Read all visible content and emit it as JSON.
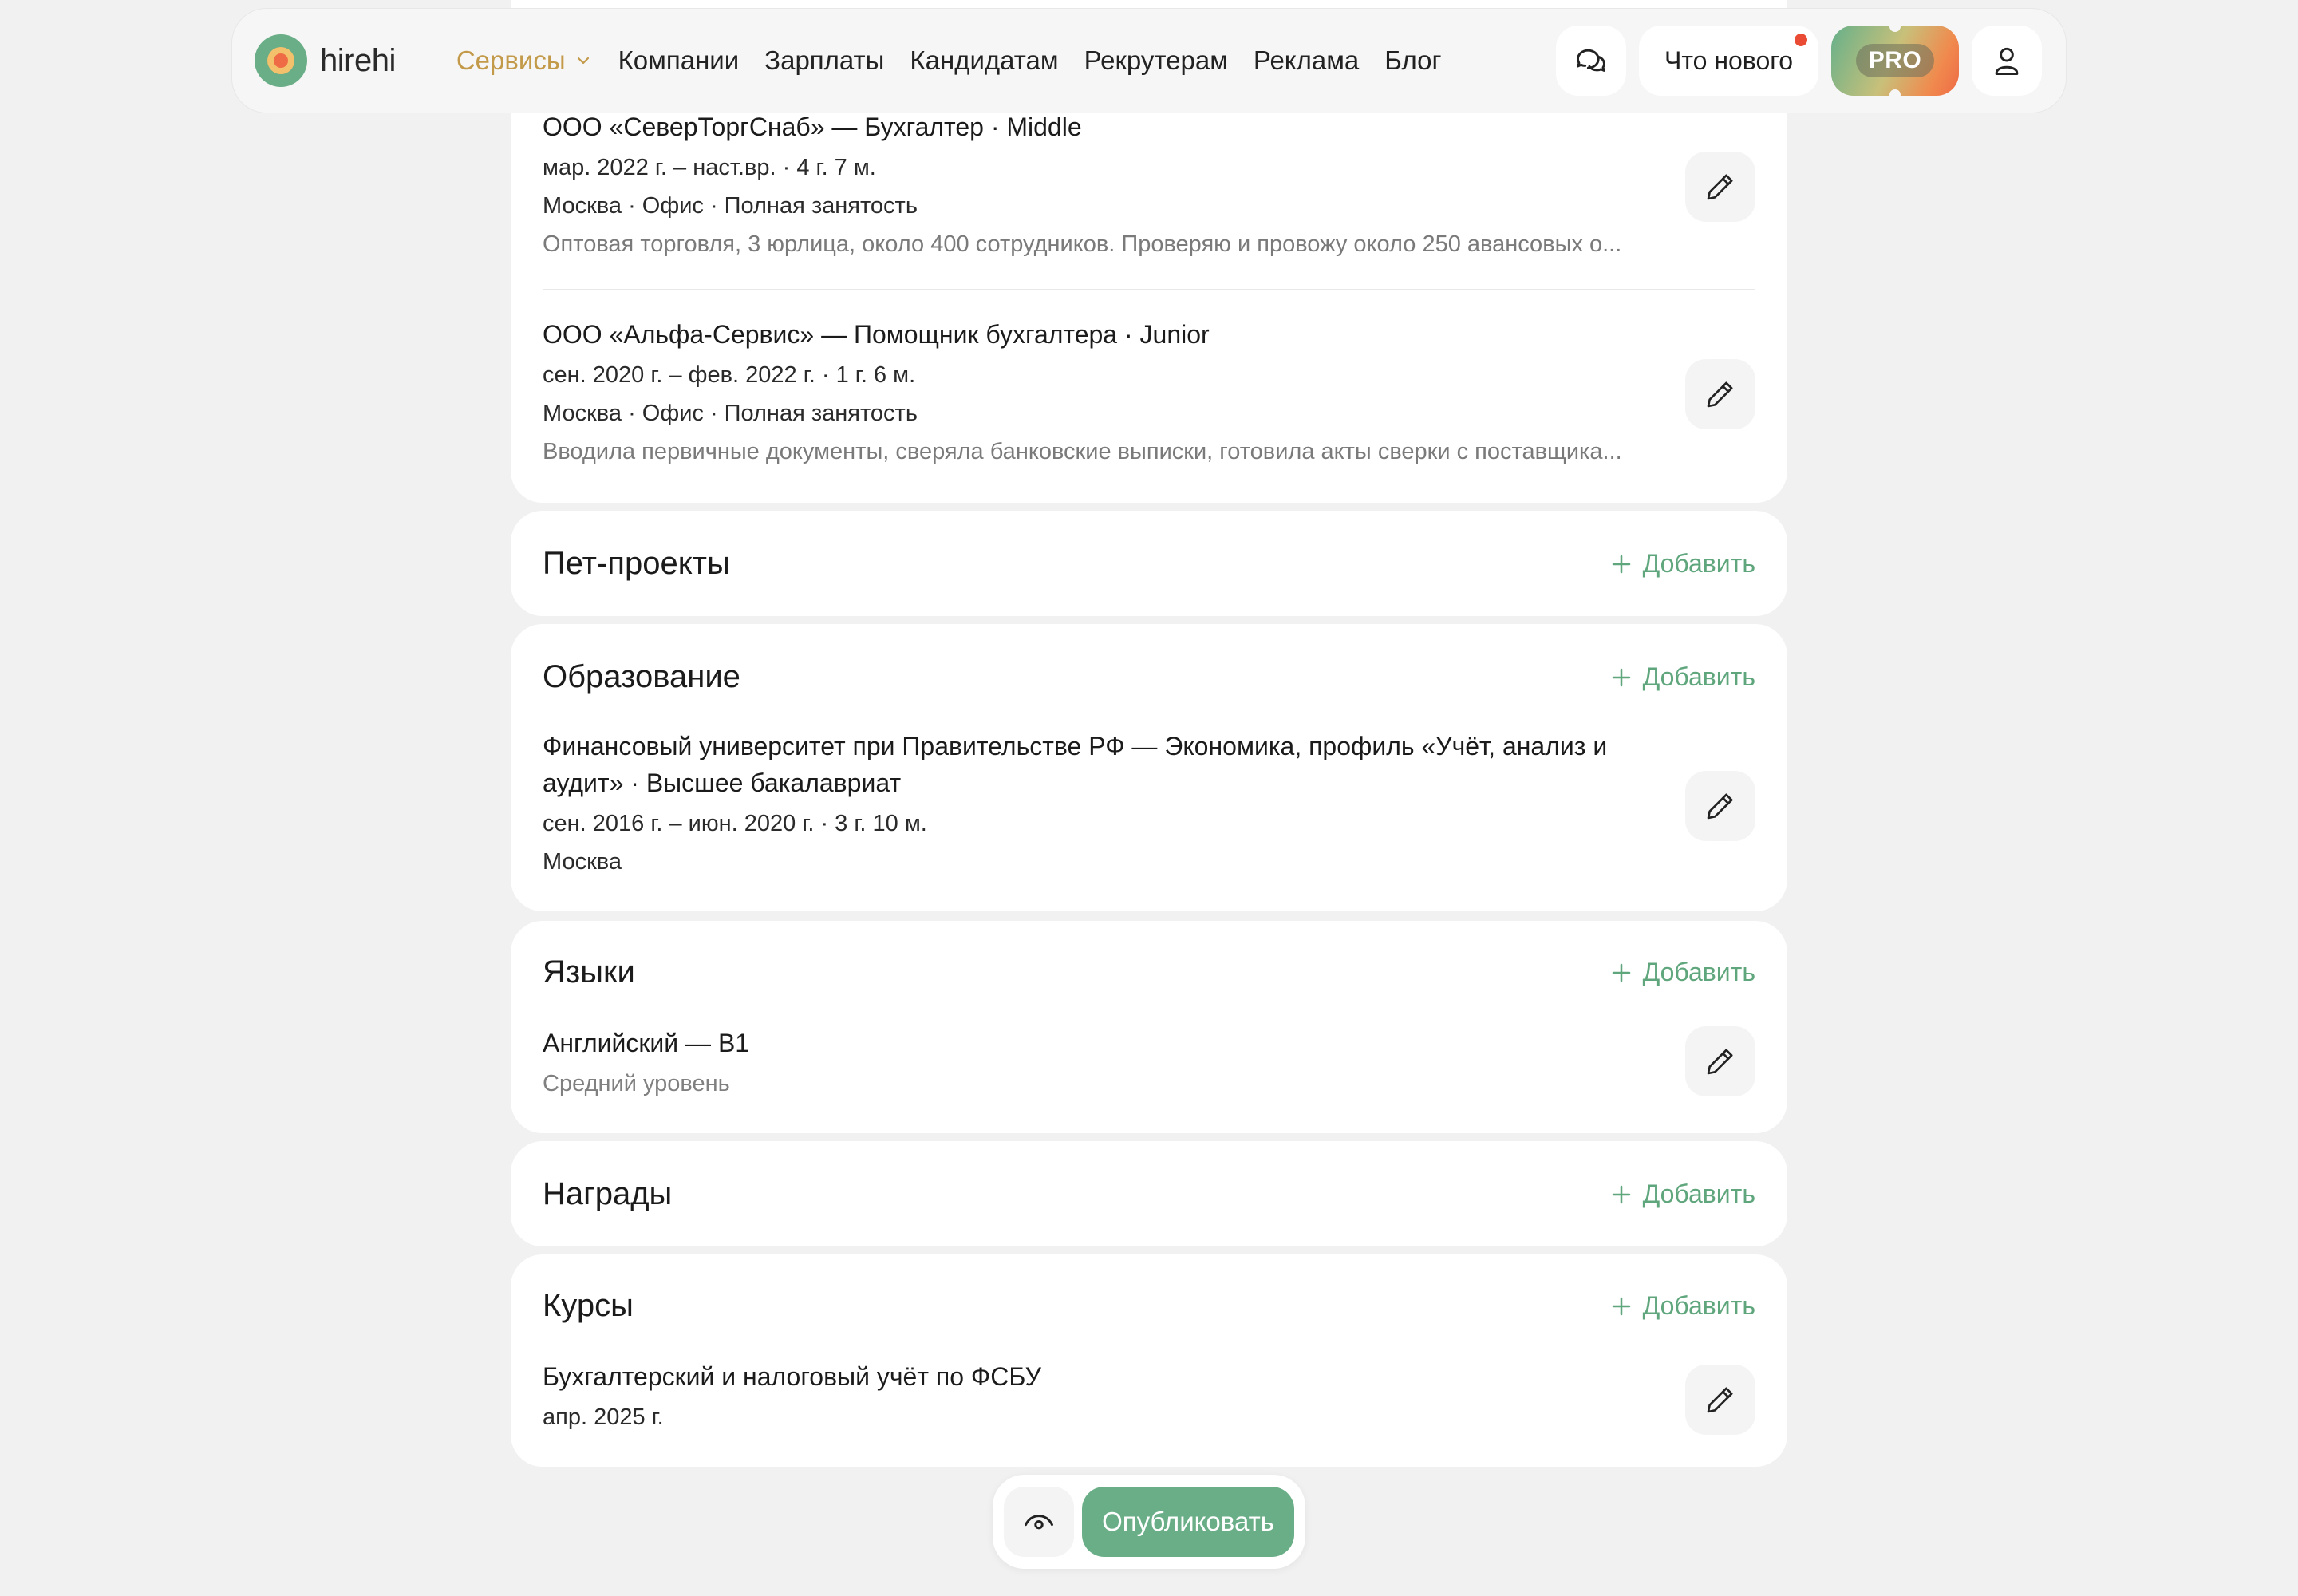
{
  "header": {
    "logo_text": "hirehi",
    "nav": {
      "services": "Сервисы",
      "companies": "Компании",
      "salaries": "Зарплаты",
      "candidates": "Кандидатам",
      "recruiters": "Рекрутерам",
      "ads": "Реклама",
      "blog": "Блог"
    },
    "whats_new": "Что нового",
    "pro": "PRO"
  },
  "experience": {
    "items": [
      {
        "title": "ООО «СеверТоргСнаб» — Бухгалтер · Middle",
        "period": "мар. 2022 г. – наст.вр. · 4 г. 7 м.",
        "location": "Москва · Офис · Полная занятость",
        "description": "Оптовая торговля, 3 юрлица, около 400 сотрудников. Проверяю и провожу около 250 авансовых о..."
      },
      {
        "title": "ООО «Альфа-Сервис» — Помощник бухгалтера · Junior",
        "period": "сен. 2020 г. – фев. 2022 г. · 1 г. 6 м.",
        "location": "Москва · Офис · Полная занятость",
        "description": "Вводила первичные документы, сверяла банковские выписки, готовила акты сверки с поставщика..."
      }
    ]
  },
  "sections": {
    "add_label": "Добавить",
    "pet_projects": {
      "title": "Пет-проекты"
    },
    "education": {
      "title": "Образование",
      "items": [
        {
          "title_line1": "Финансовый университет при Правительстве РФ — Экономика, профиль «Учёт, анализ и",
          "title_line2": "аудит» · Высшее бакалавриат",
          "period": "сен. 2016 г. – июн. 2020 г. · 3 г. 10 м.",
          "location": "Москва"
        }
      ]
    },
    "languages": {
      "title": "Языки",
      "items": [
        {
          "name": "Английский — B1",
          "level": "Средний уровень"
        }
      ]
    },
    "awards": {
      "title": "Награды"
    },
    "courses": {
      "title": "Курсы",
      "items": [
        {
          "name": "Бухгалтерский и налоговый учёт по ФСБУ",
          "date": "апр. 2025 г."
        }
      ]
    }
  },
  "bottom_bar": {
    "publish": "Опубликовать"
  },
  "colors": {
    "accent_green": "#6aae87",
    "link_green": "#5fa67d",
    "services_gold": "#c39a4a",
    "notification_red": "#ea4b35"
  }
}
